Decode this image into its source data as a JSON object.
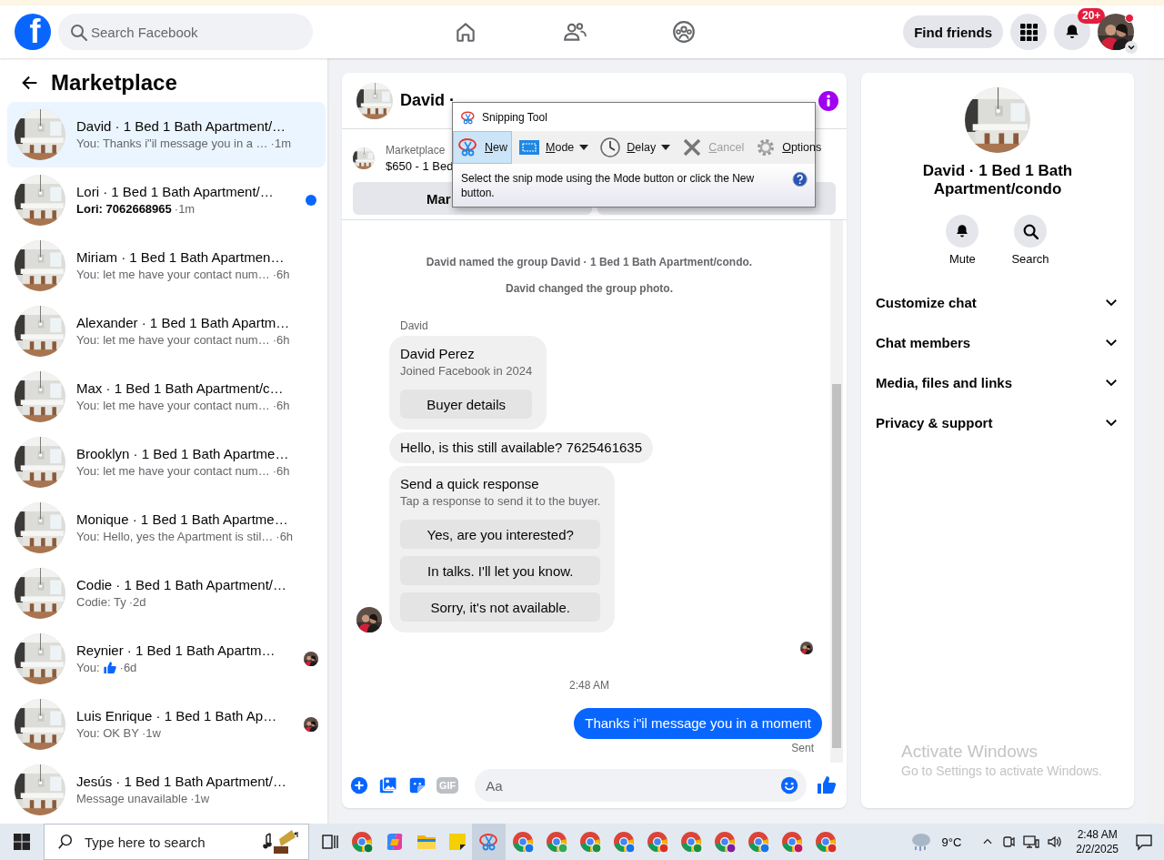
{
  "top_bar": {
    "logo_letter": "f",
    "search": {
      "placeholder": "Search Facebook"
    },
    "find_friends": "Find friends",
    "notification_badge": "20+"
  },
  "sidebar": {
    "title": "Marketplace",
    "conversations": [
      {
        "name": "David · 1 Bed 1 Bath Apartment/…",
        "preview": "You: Thanks i\"il message you in a …",
        "time": "·1m",
        "selected": true,
        "unread": false,
        "like": false,
        "seen_avatar": false
      },
      {
        "name": "Lori · 1 Bed 1 Bath Apartment/…",
        "preview": "Lori: 7062668965",
        "time": "·1m",
        "selected": false,
        "unread": true,
        "like": false,
        "seen_avatar": false
      },
      {
        "name": "Miriam · 1 Bed 1 Bath Apartmen…",
        "preview": "You: let me have your contact num…",
        "time": "·6h",
        "selected": false,
        "unread": false,
        "like": false,
        "seen_avatar": false
      },
      {
        "name": "Alexander · 1 Bed 1 Bath Apartm…",
        "preview": "You: let me have your contact num…",
        "time": "·6h",
        "selected": false,
        "unread": false,
        "like": false,
        "seen_avatar": false
      },
      {
        "name": "Max · 1 Bed 1 Bath Apartment/c…",
        "preview": "You: let me have your contact num…",
        "time": "·6h",
        "selected": false,
        "unread": false,
        "like": false,
        "seen_avatar": false
      },
      {
        "name": "Brooklyn · 1 Bed 1 Bath Apartme…",
        "preview": "You: let me have your contact num…",
        "time": "·6h",
        "selected": false,
        "unread": false,
        "like": false,
        "seen_avatar": false
      },
      {
        "name": "Monique · 1 Bed 1 Bath Apartme…",
        "preview": "You: Hello, yes the Apartment is stil…",
        "time": "·6h",
        "selected": false,
        "unread": false,
        "like": false,
        "seen_avatar": false
      },
      {
        "name": "Codie · 1 Bed 1 Bath Apartment/…",
        "preview": "Codie: Ty",
        "time": "·2d",
        "selected": false,
        "unread": false,
        "like": false,
        "seen_avatar": false
      },
      {
        "name": "Reynier · 1 Bed 1 Bath Apartm…",
        "preview": "You:",
        "time": "·6d",
        "selected": false,
        "unread": false,
        "like": true,
        "seen_avatar": true
      },
      {
        "name": "Luis Enrique · 1 Bed 1 Bath Ap…",
        "preview": "You: OK BY",
        "time": "·1w",
        "selected": false,
        "unread": false,
        "like": false,
        "seen_avatar": true
      },
      {
        "name": "Jesús · 1 Bed 1 Bath Apartment/…",
        "preview": "Message unavailable",
        "time": "·1w",
        "selected": false,
        "unread": false,
        "like": false,
        "seen_avatar": false
      }
    ]
  },
  "chat": {
    "title": "David ·",
    "listing": {
      "label": "Marketplace",
      "price": "$650 - 1 Bed",
      "button": "Mar"
    },
    "events": [
      "David named the group David · 1 Bed 1 Bath Apartment/condo.",
      "David changed the group photo."
    ],
    "sender": "David",
    "buyer_card": {
      "name": "David Perez",
      "subtitle": "Joined Facebook in 2024",
      "button": "Buyer details"
    },
    "incoming": "Hello, is this still available? 7625461635",
    "quick_response": {
      "title": "Send a quick response",
      "subtitle": "Tap a response to send it to the buyer.",
      "responses": [
        "Yes, are you interested?",
        "In talks. I'll let you know.",
        "Sorry, it's not available."
      ]
    },
    "time": "2:48 AM",
    "outgoing": "Thanks i\"il message you in a moment",
    "status": "Sent",
    "composer": {
      "gif": "GIF",
      "placeholder": "Aa"
    }
  },
  "details": {
    "title": "David · 1 Bed 1 Bath Apartment/condo",
    "actions": [
      {
        "kind": "mute",
        "label": "Mute"
      },
      {
        "kind": "search",
        "label": "Search"
      }
    ],
    "sections": [
      {
        "label": "Customize chat",
        "expanded": false
      },
      {
        "label": "Chat members",
        "expanded": false
      },
      {
        "label": "Media, files and links",
        "expanded": false
      },
      {
        "label": "Privacy & support",
        "expanded": false
      }
    ]
  },
  "snipping_tool": {
    "title": "Snipping Tool",
    "tools": [
      {
        "kind": "new",
        "label": "New",
        "selected": true,
        "disabled": false
      },
      {
        "kind": "mode",
        "label": "Mode",
        "selected": false,
        "disabled": false
      },
      {
        "kind": "delay",
        "label": "Delay",
        "selected": false,
        "disabled": false
      },
      {
        "kind": "cancel",
        "label": "Cancel",
        "selected": false,
        "disabled": true
      },
      {
        "kind": "options",
        "label": "Options",
        "selected": false,
        "disabled": false
      }
    ],
    "hint": "Select the snip mode using the Mode button or click the New button."
  },
  "os_notice": {
    "title": "Activate Windows",
    "text": "Go to Settings to activate Windows."
  },
  "taskbar": {
    "search": "Type here to search",
    "weather": "9°C",
    "time": "2:48 AM",
    "date": "2/2/2025"
  }
}
